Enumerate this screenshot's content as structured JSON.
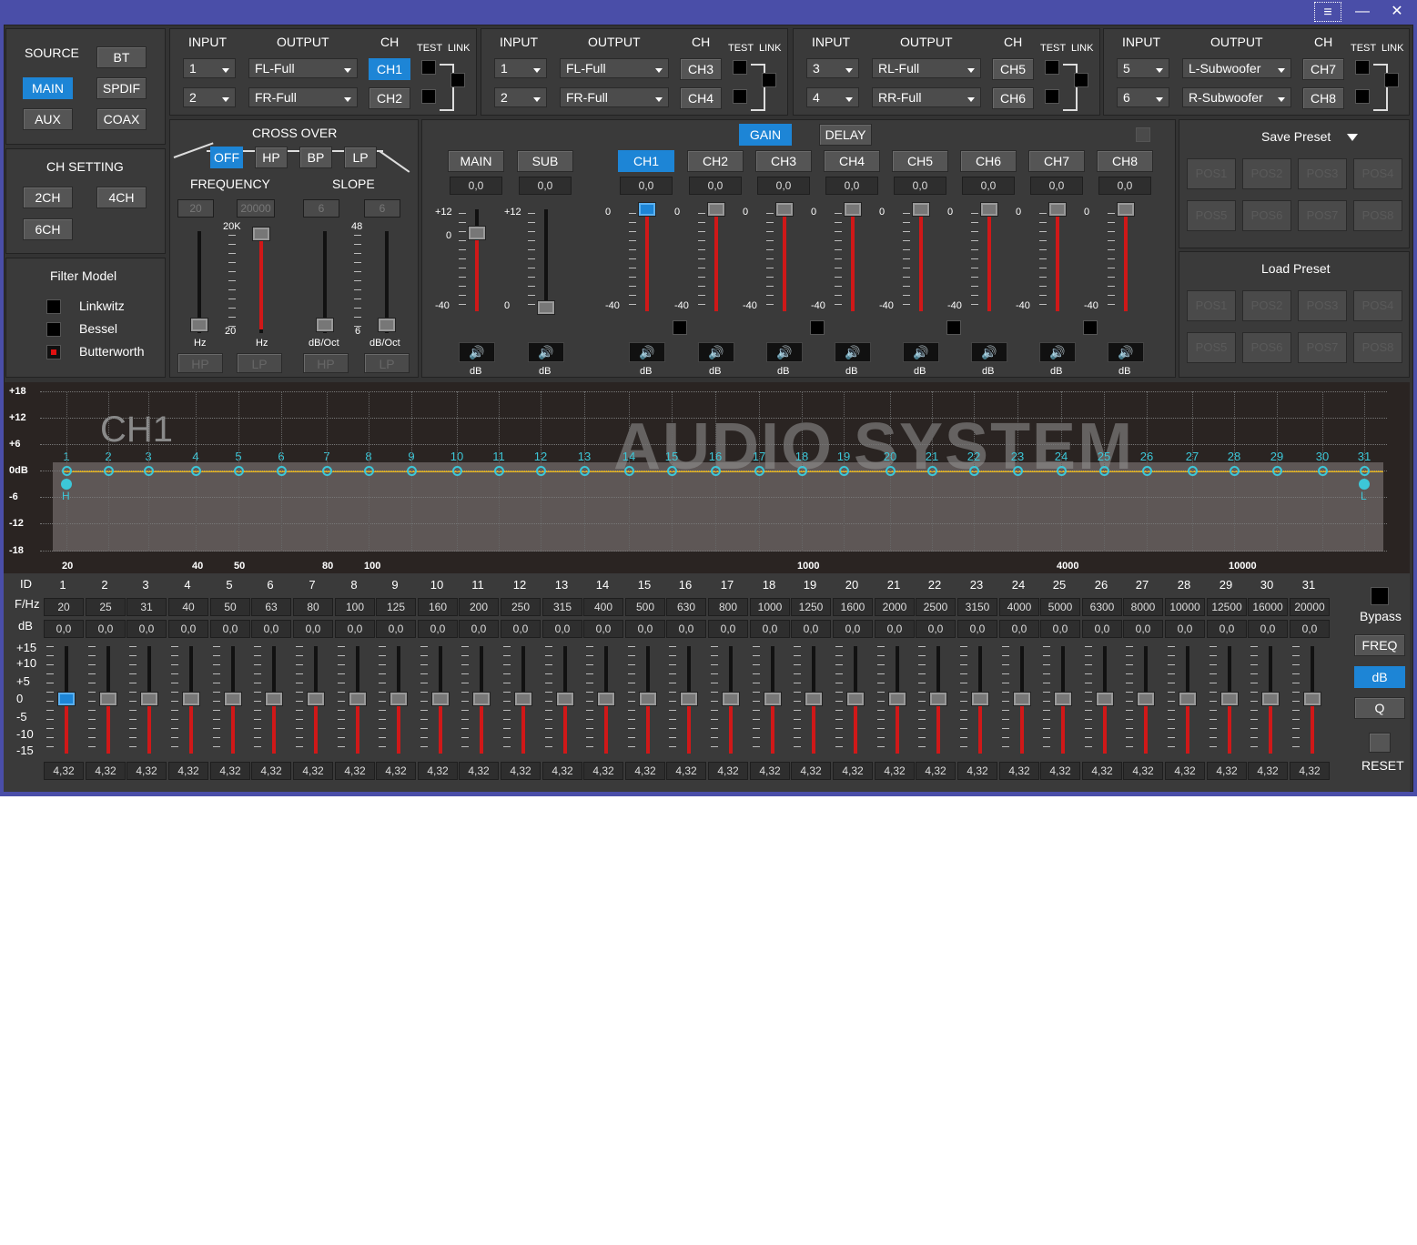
{
  "window": {
    "menu_icon": "≡",
    "minimize": "—",
    "close": "✕"
  },
  "source": {
    "title": "SOURCE",
    "buttons": [
      "BT",
      "MAIN",
      "SPDIF",
      "AUX",
      "COAX"
    ],
    "active": "MAIN"
  },
  "ch_setting": {
    "title": "CH SETTING",
    "buttons": [
      "2CH",
      "4CH",
      "6CH"
    ]
  },
  "filter_model": {
    "title": "Filter Model",
    "options": [
      "Linkwitz",
      "Bessel",
      "Butterworth"
    ],
    "selected": "Butterworth"
  },
  "routing": [
    {
      "input_label": "INPUT",
      "output_label": "OUTPUT",
      "ch_label": "CH",
      "test_label": "TEST",
      "link_label": "LINK",
      "rows": [
        {
          "input": "1",
          "output": "FL-Full",
          "ch": "CH1",
          "active": true
        },
        {
          "input": "2",
          "output": "FR-Full",
          "ch": "CH2",
          "active": false
        }
      ]
    },
    {
      "input_label": "INPUT",
      "output_label": "OUTPUT",
      "ch_label": "CH",
      "test_label": "TEST",
      "link_label": "LINK",
      "rows": [
        {
          "input": "1",
          "output": "FL-Full",
          "ch": "CH3",
          "active": false
        },
        {
          "input": "2",
          "output": "FR-Full",
          "ch": "CH4",
          "active": false
        }
      ]
    },
    {
      "input_label": "INPUT",
      "output_label": "OUTPUT",
      "ch_label": "CH",
      "test_label": "TEST",
      "link_label": "LINK",
      "rows": [
        {
          "input": "3",
          "output": "RL-Full",
          "ch": "CH5",
          "active": false
        },
        {
          "input": "4",
          "output": "RR-Full",
          "ch": "CH6",
          "active": false
        }
      ]
    },
    {
      "input_label": "INPUT",
      "output_label": "OUTPUT",
      "ch_label": "CH",
      "test_label": "TEST",
      "link_label": "LINK",
      "rows": [
        {
          "input": "5",
          "output": "L-Subwoofer",
          "ch": "CH7",
          "active": false
        },
        {
          "input": "6",
          "output": "R-Subwoofer",
          "ch": "CH8",
          "active": false
        }
      ]
    }
  ],
  "crossover": {
    "title": "CROSS OVER",
    "modes": [
      "OFF",
      "HP",
      "BP",
      "LP"
    ],
    "active": "OFF",
    "frequency_label": "FREQUENCY",
    "slope_label": "SLOPE",
    "freq_low": "20",
    "freq_high": "20000",
    "slope_a": "6",
    "slope_b": "6",
    "scale_top_freq": "20K",
    "scale_bot_freq": "20",
    "scale_top_slope": "48",
    "scale_bot_slope": "6",
    "unit_hz_a": "Hz",
    "unit_hz_b": "Hz",
    "unit_slope_a": "dB/Oct",
    "unit_slope_b": "dB/Oct",
    "bottom_buttons": [
      "HP",
      "LP",
      "HP",
      "LP"
    ]
  },
  "gain": {
    "tabs": [
      "GAIN",
      "DELAY"
    ],
    "active_tab": "GAIN",
    "main": {
      "label": "MAIN",
      "value": "0,0",
      "top": "+12",
      "mid": "0",
      "bot": "-40",
      "unit": "dB"
    },
    "sub": {
      "label": "SUB",
      "value": "0,0",
      "top": "+12",
      "bot": "0",
      "unit": "dB"
    },
    "channels": [
      {
        "label": "CH1",
        "value": "0,0",
        "active": true
      },
      {
        "label": "CH2",
        "value": "0,0"
      },
      {
        "label": "CH3",
        "value": "0,0"
      },
      {
        "label": "CH4",
        "value": "0,0"
      },
      {
        "label": "CH5",
        "value": "0,0"
      },
      {
        "label": "CH6",
        "value": "0,0"
      },
      {
        "label": "CH7",
        "value": "0,0"
      },
      {
        "label": "CH8",
        "value": "0,0"
      }
    ],
    "ch_top": "0",
    "ch_bot": "-40",
    "unit": "dB"
  },
  "save_preset": {
    "title": "Save Preset",
    "slots": [
      "POS1",
      "POS2",
      "POS3",
      "POS4",
      "POS5",
      "POS6",
      "POS7",
      "POS8"
    ]
  },
  "load_preset": {
    "title": "Load Preset",
    "slots": [
      "POS1",
      "POS2",
      "POS3",
      "POS4",
      "POS5",
      "POS6",
      "POS7",
      "POS8"
    ]
  },
  "graph": {
    "channel": "CH1",
    "y_labels": [
      "+18",
      "+12",
      "+6",
      "0dB",
      "-6",
      "-12",
      "-18"
    ],
    "x_labels": [
      "20",
      "40",
      "50",
      "80",
      "100",
      "1000",
      "4000",
      "10000"
    ],
    "hp_marker": "H",
    "lp_marker": "L",
    "watermark": "AUDIO SYSTEM"
  },
  "eq": {
    "id_label": "ID",
    "freq_label": "F/Hz",
    "db_label": "dB",
    "ids": [
      "1",
      "2",
      "3",
      "4",
      "5",
      "6",
      "7",
      "8",
      "9",
      "10",
      "11",
      "12",
      "13",
      "14",
      "15",
      "16",
      "17",
      "18",
      "19",
      "20",
      "21",
      "22",
      "23",
      "24",
      "25",
      "26",
      "27",
      "28",
      "29",
      "30",
      "31"
    ],
    "freqs": [
      "20",
      "25",
      "31",
      "40",
      "50",
      "63",
      "80",
      "100",
      "125",
      "160",
      "200",
      "250",
      "315",
      "400",
      "500",
      "630",
      "800",
      "1000",
      "1250",
      "1600",
      "2000",
      "2500",
      "3150",
      "4000",
      "5000",
      "6300",
      "8000",
      "10000",
      "12500",
      "16000",
      "20000"
    ],
    "db": "0,0",
    "q": "4,32",
    "scale": [
      "+15",
      "+10",
      "+5",
      "0",
      "-5",
      "-10",
      "-15"
    ],
    "side": {
      "bypass": "Bypass",
      "freq": "FREQ",
      "db": "dB",
      "q": "Q",
      "reset": "RESET",
      "active": "dB"
    }
  }
}
